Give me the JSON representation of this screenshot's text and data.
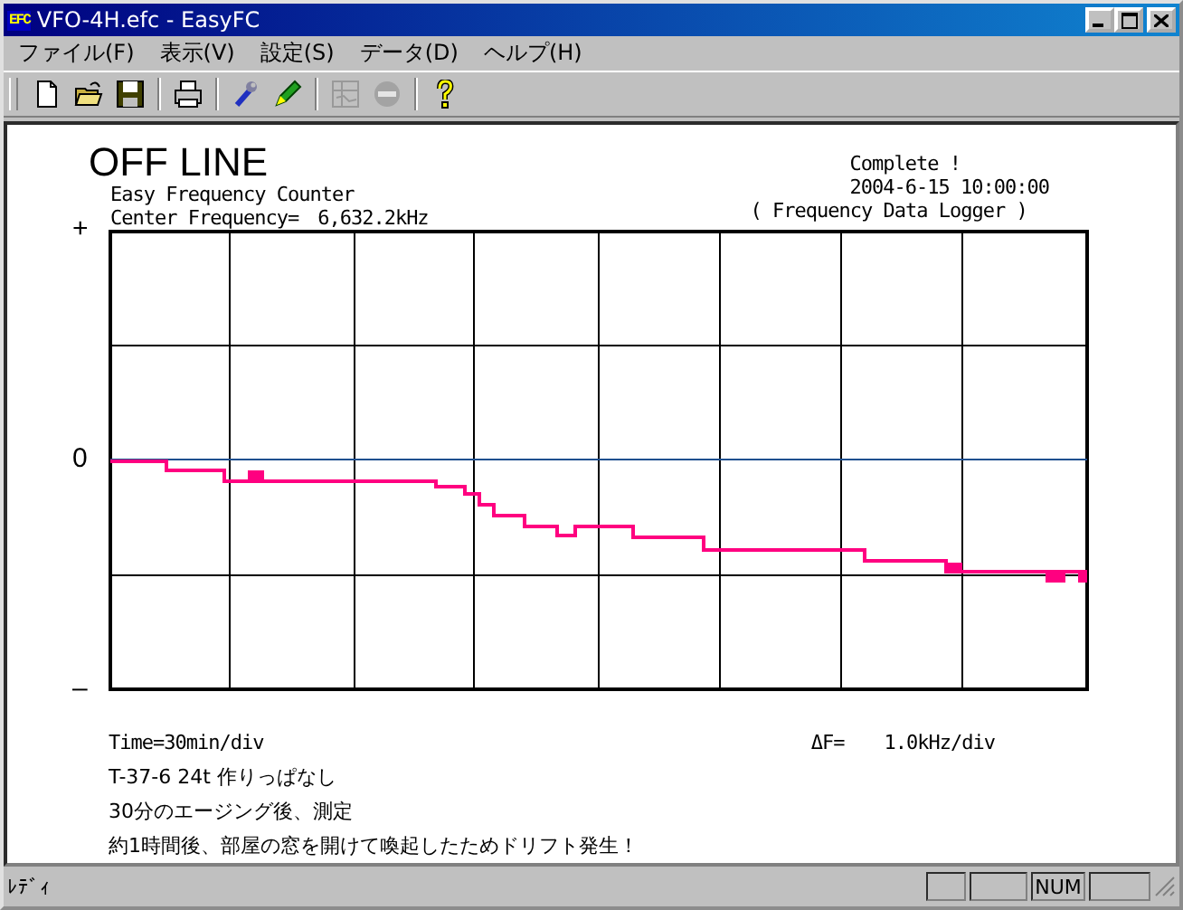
{
  "window": {
    "title": "VFO-4H.efc - EasyFC",
    "app_icon": "EFC"
  },
  "menu": [
    "ファイル(F)",
    "表示(V)",
    "設定(S)",
    "データ(D)",
    "ヘルプ(H)"
  ],
  "toolbar": [
    {
      "kind": "new",
      "disabled": false
    },
    {
      "kind": "open",
      "disabled": false
    },
    {
      "kind": "save",
      "disabled": false
    },
    {
      "kind": "sep"
    },
    {
      "kind": "print",
      "disabled": false
    },
    {
      "kind": "sep"
    },
    {
      "kind": "wrench",
      "disabled": false
    },
    {
      "kind": "pen",
      "disabled": false
    },
    {
      "kind": "sep"
    },
    {
      "kind": "graph",
      "disabled": true
    },
    {
      "kind": "stop",
      "disabled": true
    },
    {
      "kind": "sep"
    },
    {
      "kind": "help",
      "disabled": false
    }
  ],
  "header": {
    "status": "OFF LINE",
    "subtitle": "Easy Frequency Counter",
    "center_frequency": "Center Frequency=　6,632.2kHz",
    "state": "Complete !",
    "datetime": "2004-6-15  10:00:00",
    "mode": "( Frequency Data Logger )"
  },
  "chart": {
    "y_top": "+",
    "y_mid": "0",
    "y_bottom": "–"
  },
  "footer": {
    "time_scale": "Time=30min/div",
    "delta_label": "ΔF=",
    "delta_value": "1.0kHz/div"
  },
  "notes": [
    "T-37-6  24t 作りっぱなし",
    "30分のエージング後、測定",
    "約1時間後、部屋の窓を開けて喚起したためドリフト発生！"
  ],
  "status_bar": {
    "text": "ﾚﾃﾞｨ",
    "num_indicator": "NUM"
  }
}
